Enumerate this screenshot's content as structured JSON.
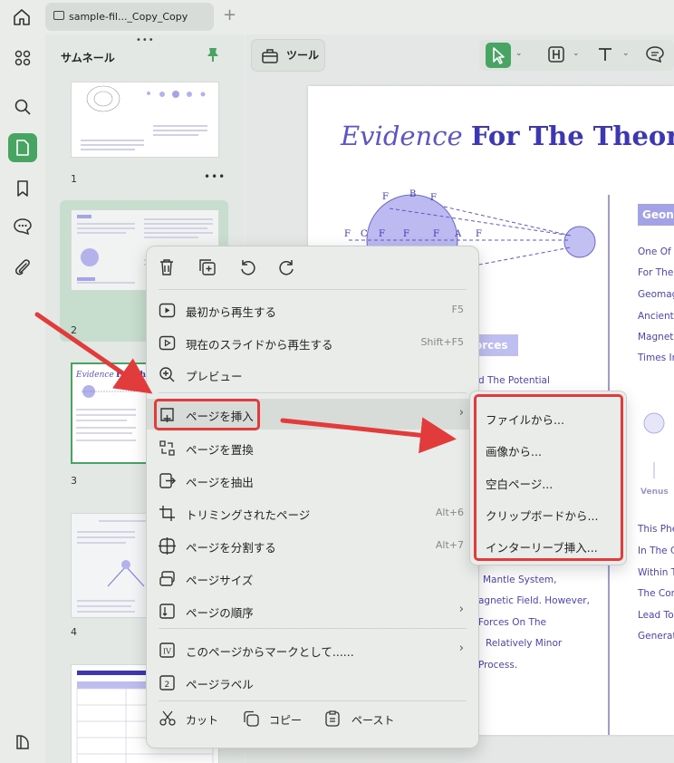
{
  "tab": {
    "title": "sample-fil..._Copy_Copy",
    "new_tab": "+"
  },
  "sidebar": {
    "title": "サムネール",
    "grip": "•••",
    "pages": [
      {
        "number": "1",
        "more": "•••"
      },
      {
        "number": "2"
      },
      {
        "number": "3"
      },
      {
        "number": "4"
      }
    ]
  },
  "toolbar": {
    "tool_label": "ツール"
  },
  "document": {
    "title_italic": "Evidence",
    "title_bold": "For The Theor",
    "tag_geo": "Geon",
    "tag_forces": "orces",
    "right_column": [
      "One Of",
      "For The",
      "Geomag",
      "Ancient",
      "Magnet",
      "Times In",
      "This Phe",
      "In The C",
      "Within T",
      "The Cor",
      "Lead To",
      "Generat"
    ],
    "middle_texts": [
      "d The Potential",
      "Mantle System,",
      "agnetic Field. However,",
      "Forces On The",
      "Relatively Minor",
      "Process."
    ],
    "venus_label": "Venus"
  },
  "context_menu": {
    "items": [
      {
        "label": "最初から再生する",
        "shortcut": "F5"
      },
      {
        "label": "現在のスライドから再生する",
        "shortcut": "Shift+F5"
      },
      {
        "label": "プレビュー",
        "shortcut": ""
      },
      {
        "label": "ページを挿入",
        "shortcut": "",
        "submenu": true
      },
      {
        "label": "ページを置換",
        "shortcut": ""
      },
      {
        "label": "ページを抽出",
        "shortcut": ""
      },
      {
        "label": "トリミングされたページ",
        "shortcut": "Alt+6"
      },
      {
        "label": "ページを分割する",
        "shortcut": "Alt+7"
      },
      {
        "label": "ページサイズ",
        "shortcut": ""
      },
      {
        "label": "ページの順序",
        "shortcut": "",
        "submenu": true
      },
      {
        "label": "このページからマークとして......",
        "shortcut": "",
        "submenu": true
      },
      {
        "label": "ページラベル",
        "shortcut": ""
      }
    ],
    "bottom": {
      "cut": "カット",
      "copy": "コピー",
      "paste": "ペースト"
    }
  },
  "insert_submenu": {
    "items": [
      "ファイルから...",
      "画像から...",
      "空白ページ...",
      "クリップボードから...",
      "インターリーブ挿入..."
    ]
  },
  "colors": {
    "accent_green": "#48a463",
    "annotation_red": "#e23b3b",
    "doc_purple": "#3d37b3"
  }
}
